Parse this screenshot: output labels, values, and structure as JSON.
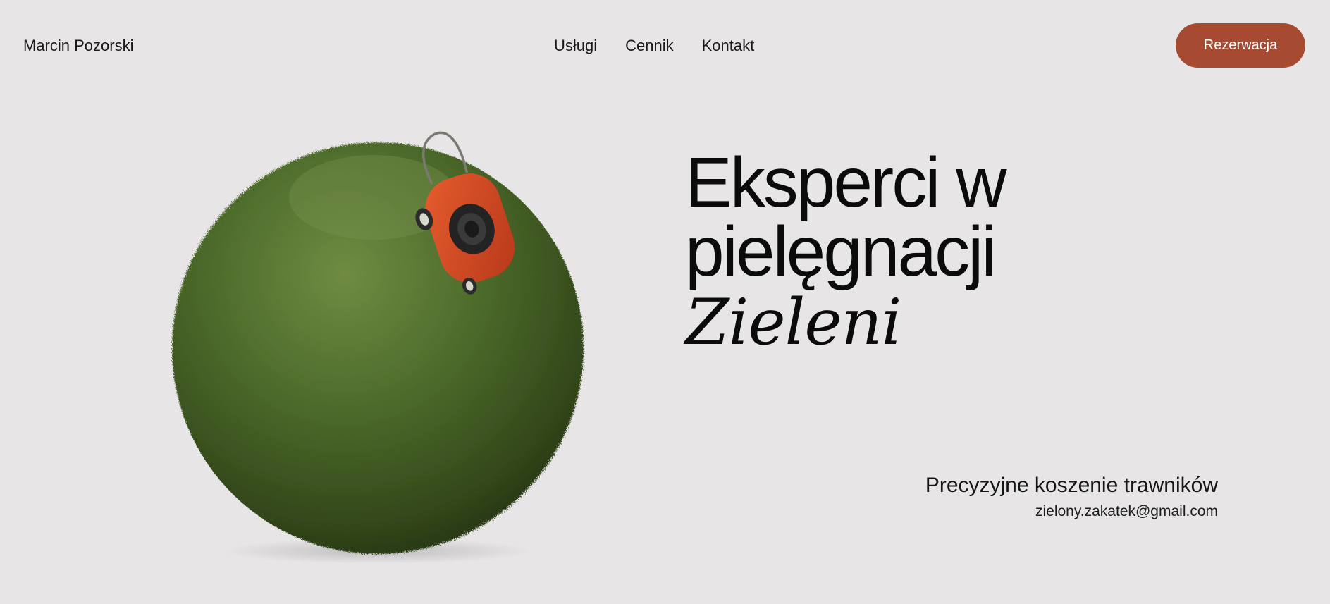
{
  "header": {
    "brand": "Marcin Pozorski",
    "nav": [
      {
        "label": "Usługi"
      },
      {
        "label": "Cennik"
      },
      {
        "label": "Kontakt"
      }
    ],
    "cta_label": "Rezerwacja"
  },
  "hero": {
    "headline_line1": "Eksperci w",
    "headline_line2": "pielęgnacji",
    "headline_accent": "Zieleni",
    "service": "Precyzyjne koszenie trawników",
    "email": "zielony.zakatek@gmail.com"
  },
  "colors": {
    "background": "#e7e5e6",
    "accent": "#a64a32",
    "grass": "#3f5a22",
    "mower": "#d24a22"
  },
  "image": {
    "subject": "grass-sphere-with-lawn-mower"
  }
}
